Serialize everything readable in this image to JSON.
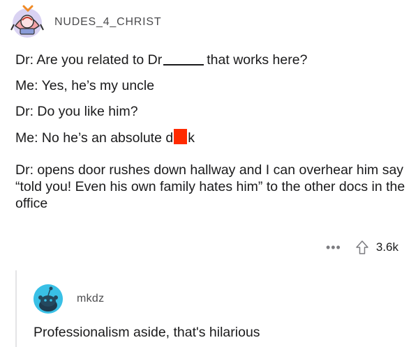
{
  "post": {
    "username": "NUDES_4_CHRIST",
    "line1_before": "Dr: Are you related to Dr",
    "line1_after": "that works here?",
    "line2": "Me: Yes, he’s my uncle",
    "line3": "Dr: Do you like him?",
    "line4_before": "Me: No he’s an absolute d",
    "line4_after": "k",
    "line5": "Dr: opens door rushes down hallway and I can overhear him say “told you! Even his own family hates him” to the other docs in the office",
    "more_label": "•••",
    "score": "3.6k",
    "avatar_icon": "avatar-icon",
    "redaction_color": "#ff2a00"
  },
  "comment": {
    "username": "mkdz",
    "text": "Professionalism aside, that's hilarious",
    "avatar_icon": "snoo-avatar-icon",
    "avatar_color": "#39c0e6"
  }
}
